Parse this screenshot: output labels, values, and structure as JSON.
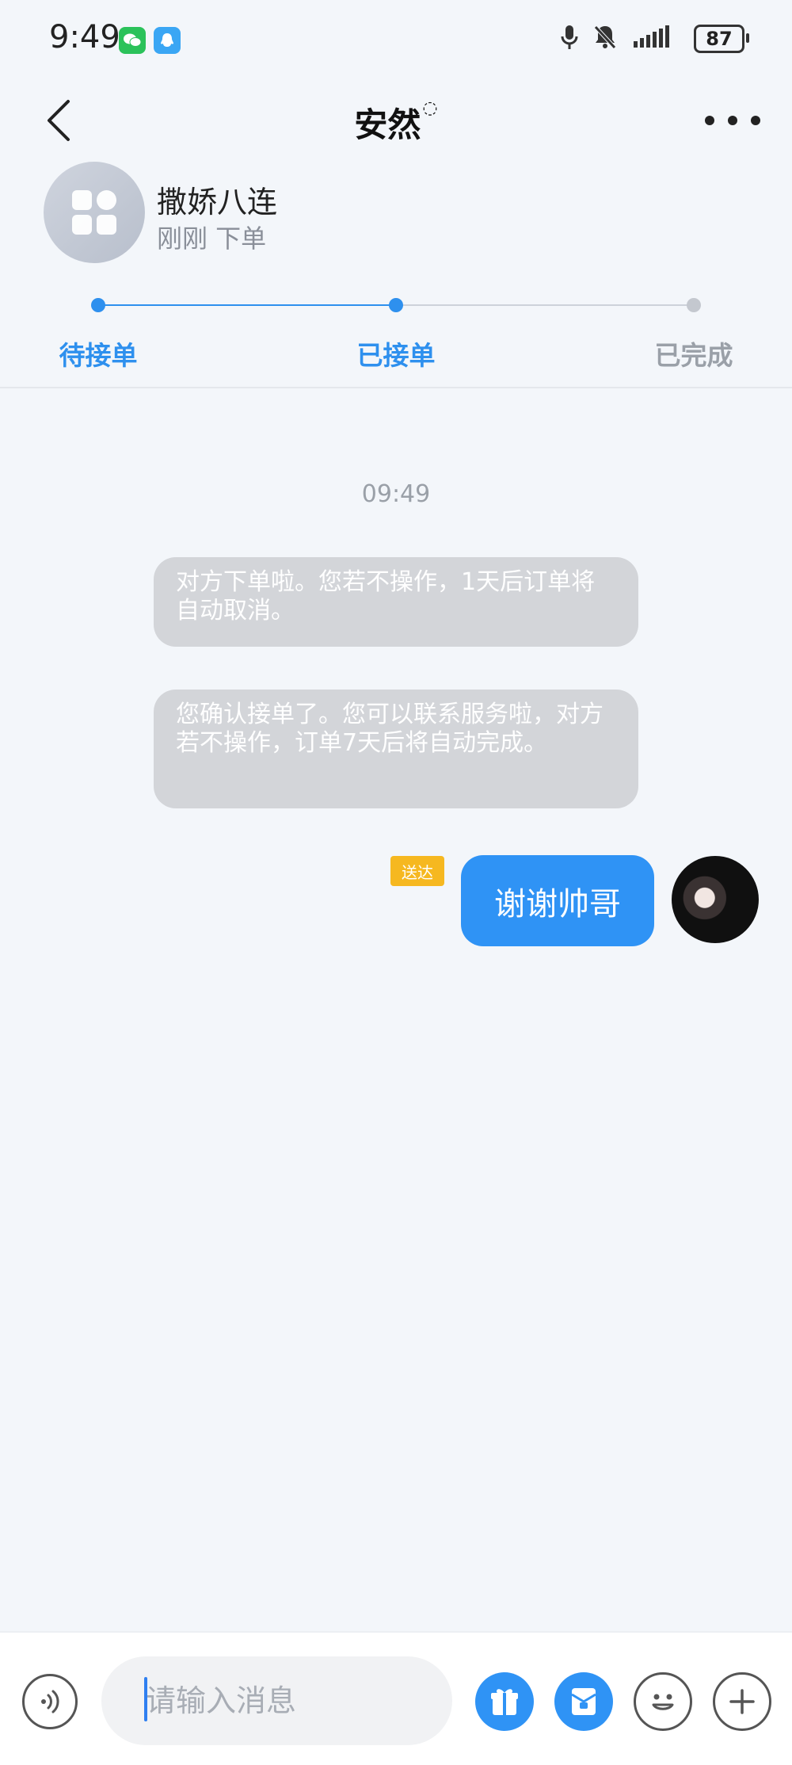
{
  "status_bar": {
    "time": "9:49",
    "battery": "87",
    "icons": [
      "wechat-icon",
      "qq-icon",
      "microphone-icon",
      "bell-off-icon",
      "signal-icon",
      "battery-icon"
    ]
  },
  "header": {
    "title": "安然",
    "icons": [
      "back-arrow-icon",
      "more-icon"
    ]
  },
  "order": {
    "name": "撒娇八连",
    "subtitle": "刚刚 下单",
    "steps": [
      {
        "label": "待接单",
        "state": "done",
        "color": "#2e90ee"
      },
      {
        "label": "已接单",
        "state": "current",
        "color": "#2e90ee"
      },
      {
        "label": "已完成",
        "state": "pending",
        "color": "#9aa0a8"
      }
    ]
  },
  "chat": {
    "timestamp": "09:49",
    "system_messages": [
      "对方下单啦。您若不操作，1天后订单将自动取消。",
      "您确认接单了。您可以联系服务啦，对方若不操作，订单7天后将自动完成。"
    ],
    "my_message": {
      "text": "谢谢帅哥",
      "status": "送达"
    }
  },
  "input_bar": {
    "placeholder": "请输入消息",
    "value": "",
    "icons": [
      "voice-icon",
      "gift-icon",
      "red-packet-icon",
      "emoji-icon",
      "plus-icon"
    ]
  },
  "colors": {
    "accent": "#2f93f5",
    "background": "#f3f6fa",
    "system_bubble": "#d3d5d9",
    "delivered_badge": "#f6b820"
  }
}
